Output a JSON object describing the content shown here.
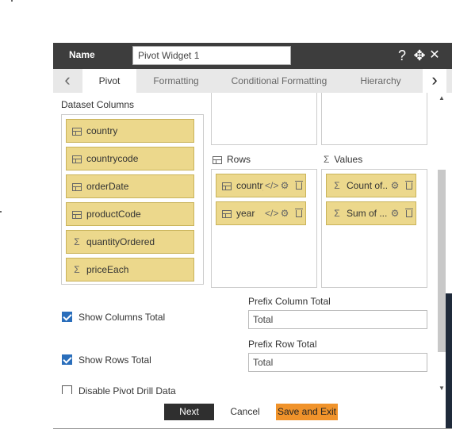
{
  "dialog": {
    "name_label": "Name",
    "name_value": "Pivot Widget 1",
    "help_icon": "?",
    "move_icon": "✥",
    "close_icon": "✕"
  },
  "tabs": {
    "prev": "‹",
    "next": "›",
    "items": [
      {
        "label": "Pivot",
        "active": true
      },
      {
        "label": "Formatting",
        "active": false
      },
      {
        "label": "Conditional Formatting",
        "active": false
      },
      {
        "label": "Hierarchy",
        "active": false
      }
    ]
  },
  "dataset": {
    "label": "Dataset Columns",
    "columns": [
      {
        "label": "country",
        "icon": "table-icon"
      },
      {
        "label": "countrycode",
        "icon": "table-icon"
      },
      {
        "label": "orderDate",
        "icon": "table-icon"
      },
      {
        "label": "productCode",
        "icon": "table-icon"
      },
      {
        "label": "quantityOrdered",
        "icon": "sigma-icon"
      },
      {
        "label": "priceEach",
        "icon": "sigma-icon"
      }
    ]
  },
  "rows": {
    "label": "Rows",
    "items": [
      {
        "label": "country"
      },
      {
        "label": "year"
      }
    ]
  },
  "values": {
    "label": "Values",
    "items": [
      {
        "label": "Count of..."
      },
      {
        "label": "Sum of ..."
      }
    ]
  },
  "options": {
    "show_columns_total": {
      "label": "Show Columns Total",
      "checked": true
    },
    "show_rows_total": {
      "label": "Show Rows Total",
      "checked": true
    },
    "disable_drill": {
      "label": "Disable Pivot Drill Data",
      "checked": false
    },
    "prefix_column_total": {
      "label": "Prefix Column Total",
      "value": "Total"
    },
    "prefix_row_total": {
      "label": "Prefix Row Total",
      "value": "Total"
    }
  },
  "footer": {
    "next_label": "Next",
    "cancel_label": "Cancel",
    "save_exit_label": "Save and Exit"
  },
  "colors": {
    "header_bg": "#3d3d3d",
    "field_bg": "#ecd88c",
    "save_bg": "#f0932b",
    "next_bg": "#2f2f2f",
    "checkbox_blue": "#2a6ebb"
  }
}
